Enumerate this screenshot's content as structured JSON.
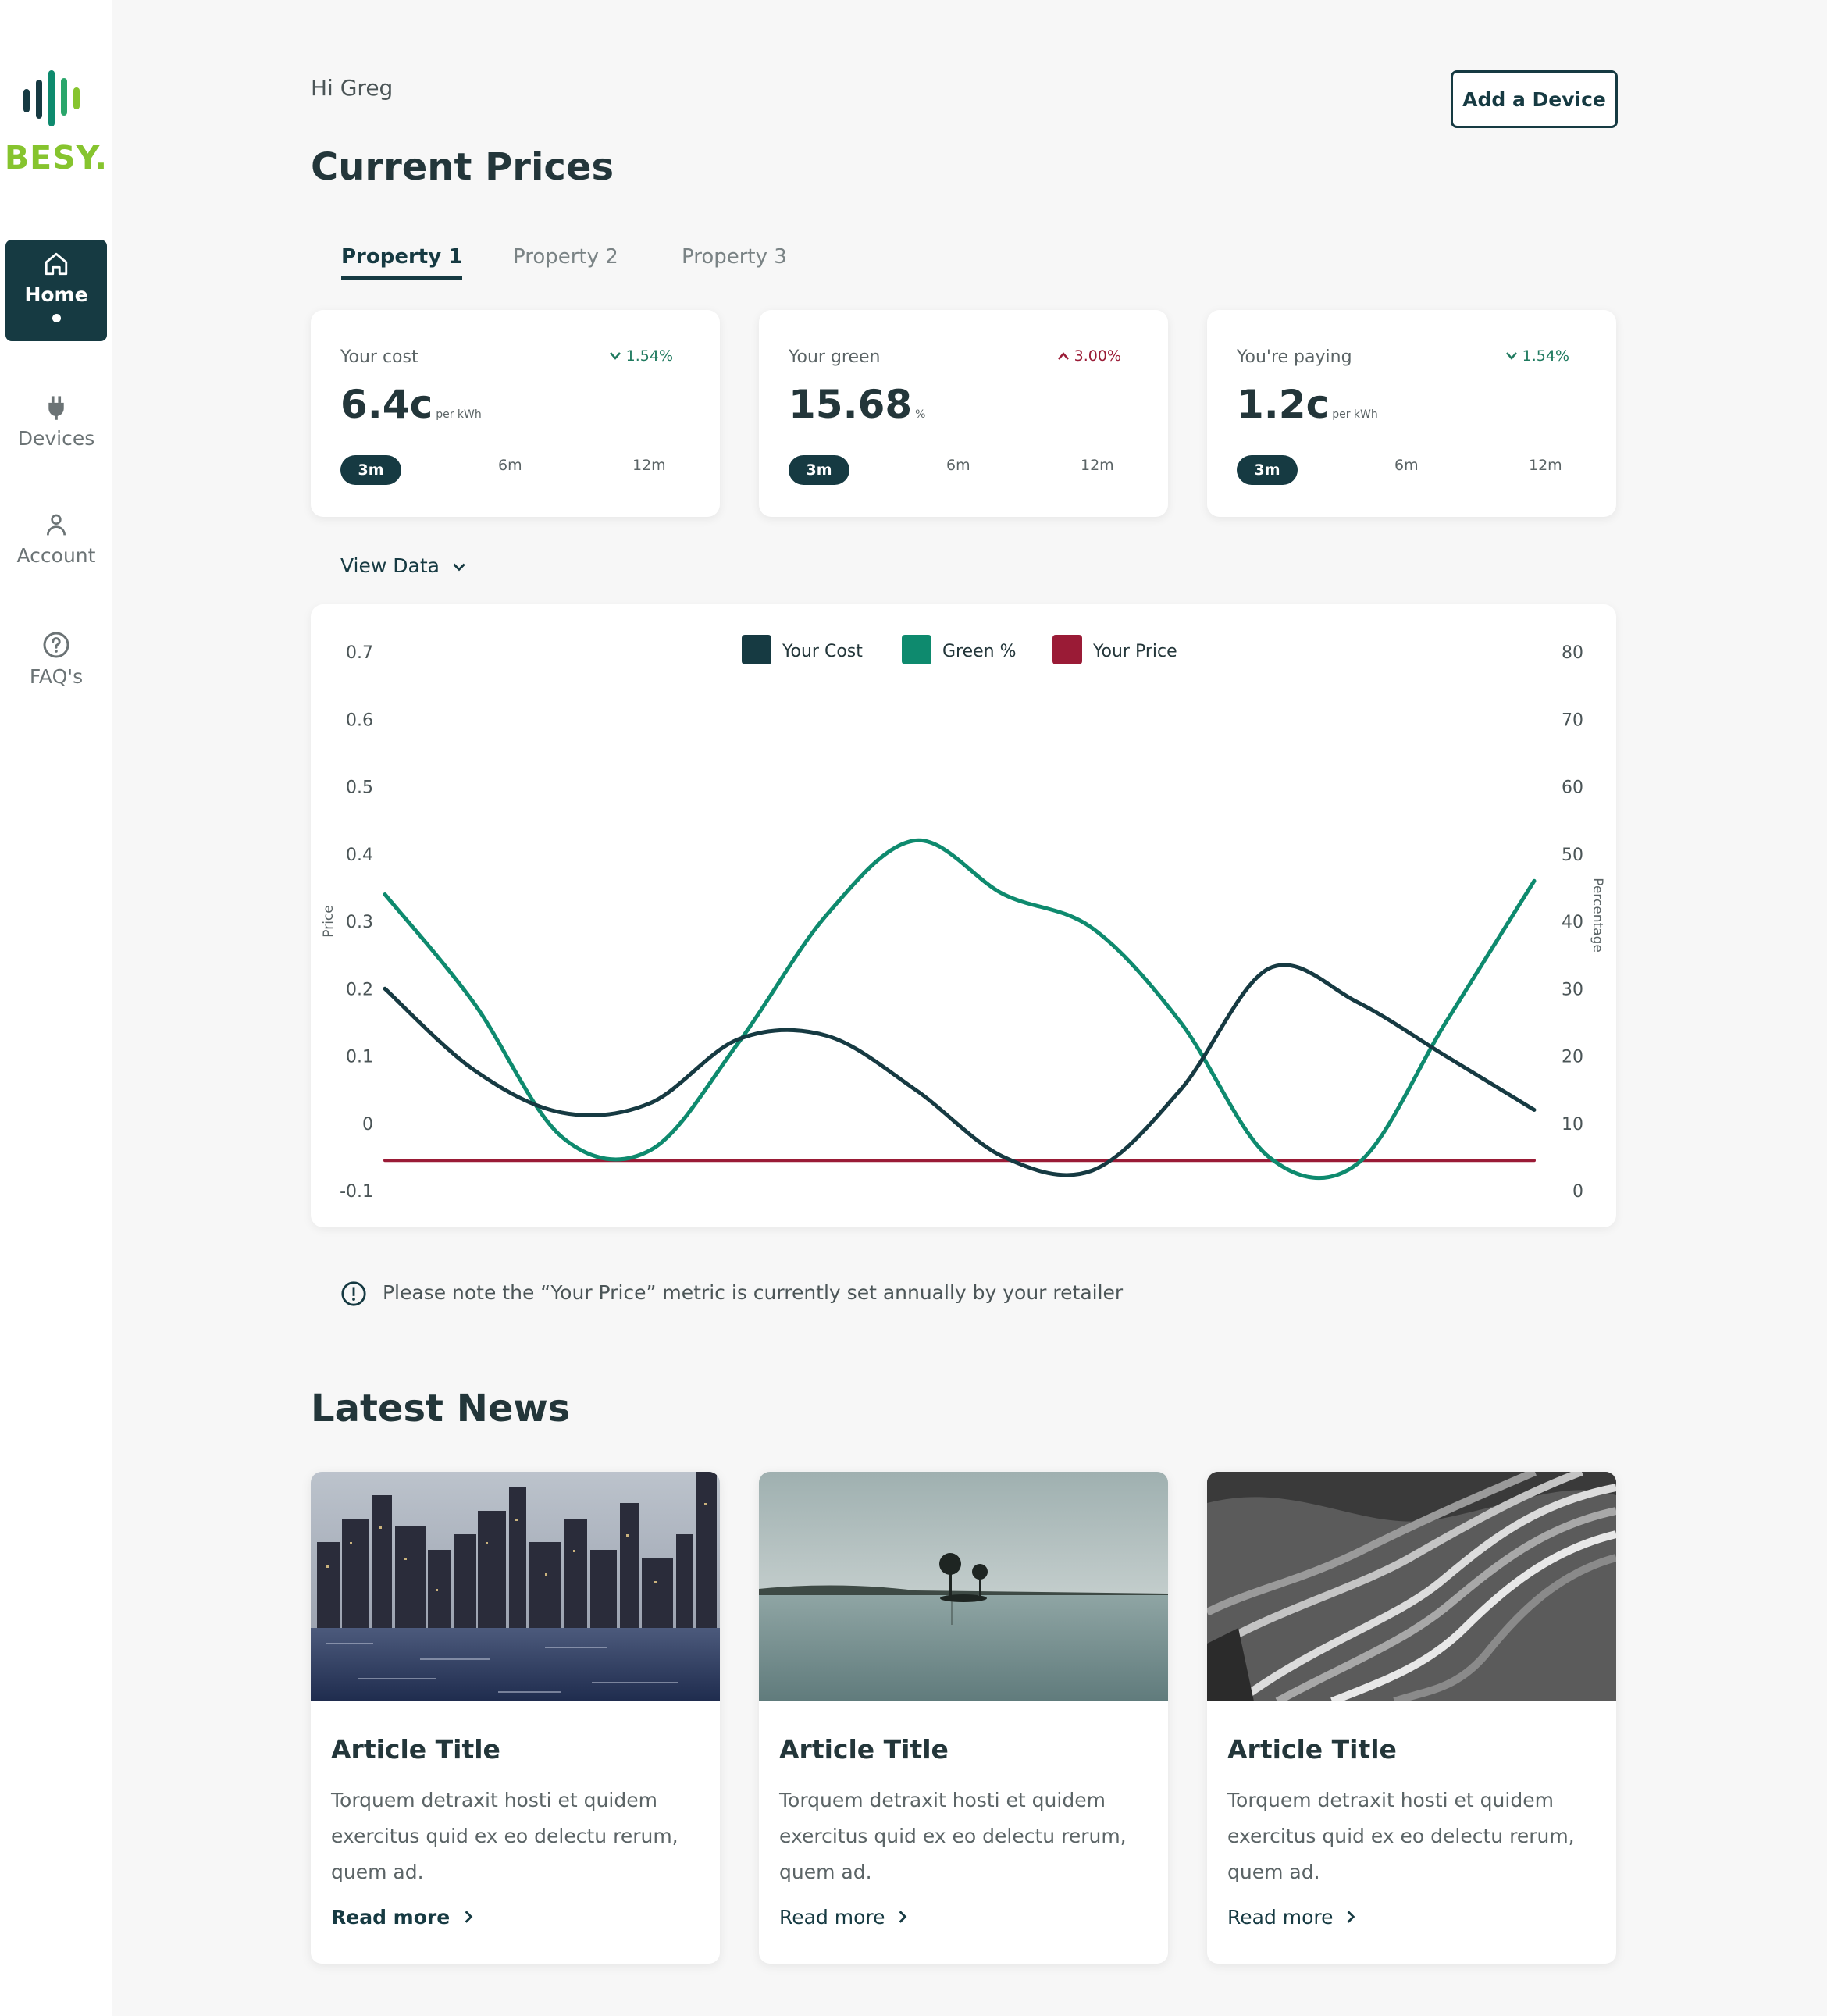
{
  "brand": {
    "name": "BESY."
  },
  "nav": [
    {
      "label": "Home",
      "icon": "home-icon",
      "active": true
    },
    {
      "label": "Devices",
      "icon": "plug-icon"
    },
    {
      "label": "Account",
      "icon": "user-icon"
    },
    {
      "label": "FAQ's",
      "icon": "help-circle-icon"
    }
  ],
  "header": {
    "greeting": "Hi Greg",
    "title": "Current Prices",
    "add_device_label": "Add a Device"
  },
  "tabs": [
    "Property 1",
    "Property 2",
    "Property 3"
  ],
  "cards": [
    {
      "label": "Your cost",
      "change": "1.54%",
      "direction": "down",
      "value": "6.4c",
      "unit": "per kWh",
      "periods": [
        "3m",
        "6m",
        "12m"
      ],
      "selected": "3m"
    },
    {
      "label": "Your green",
      "change": "3.00%",
      "direction": "up",
      "value": "15.68",
      "unit": "%",
      "periods": [
        "3m",
        "6m",
        "12m"
      ],
      "selected": "3m"
    },
    {
      "label": "You're paying",
      "change": "1.54%",
      "direction": "down",
      "value": "1.2c",
      "unit": "per kWh",
      "periods": [
        "3m",
        "6m",
        "12m"
      ],
      "selected": "3m"
    }
  ],
  "view_data_label": "View Data",
  "chart_data": {
    "type": "line",
    "ylabel": "Price",
    "y2label": "Percentage",
    "ylim": [
      -0.1,
      0.7
    ],
    "y2lim": [
      0,
      80
    ],
    "y_ticks": [
      "0.7",
      "0.6",
      "0.5",
      "0.4",
      "0.3",
      "0.2",
      "0.1",
      "0",
      "-0.1"
    ],
    "y2_ticks": [
      "80",
      "70",
      "60",
      "50",
      "40",
      "30",
      "20",
      "10",
      "0"
    ],
    "legend_position": "top-center",
    "grid": false,
    "series": [
      {
        "name": "Your Cost",
        "axis": "left",
        "color": "#163a42",
        "values": [
          0.2,
          0.08,
          0.016,
          0.03,
          0.125,
          0.13,
          0.05,
          -0.05,
          -0.07,
          0.05,
          0.23,
          0.18,
          0.1,
          0.02
        ]
      },
      {
        "name": "Green %",
        "axis": "right",
        "color": "#0e8a6e",
        "values": [
          44,
          28,
          8,
          6,
          22,
          41,
          52,
          44,
          39,
          25,
          5,
          4,
          25,
          46
        ]
      },
      {
        "name": "Your Price",
        "axis": "left",
        "color": "#9a1b36",
        "values": [
          -0.055,
          -0.055,
          -0.055,
          -0.055,
          -0.055,
          -0.055,
          -0.055,
          -0.055,
          -0.055,
          -0.055,
          -0.055,
          -0.055,
          -0.055,
          -0.055
        ]
      }
    ]
  },
  "note": "Please note the “Your Price” metric is currently set annually by your retailer",
  "news": {
    "title": "Latest News",
    "articles": [
      {
        "title": "Article Title",
        "body": "Torquem detraxit hosti et quidem exercitus quid ex eo delectu rerum, quem ad.",
        "link": "Read more",
        "image": "city-skyline-night"
      },
      {
        "title": "Article Title",
        "body": "Torquem detraxit hosti et quidem exercitus quid ex eo delectu rerum, quem ad.",
        "link": "Read more",
        "image": "lake-island-trees"
      },
      {
        "title": "Article Title",
        "body": "Torquem detraxit hosti et quidem exercitus quid ex eo delectu rerum, quem ad.",
        "link": "Read more",
        "image": "glacier-aerial"
      }
    ]
  }
}
